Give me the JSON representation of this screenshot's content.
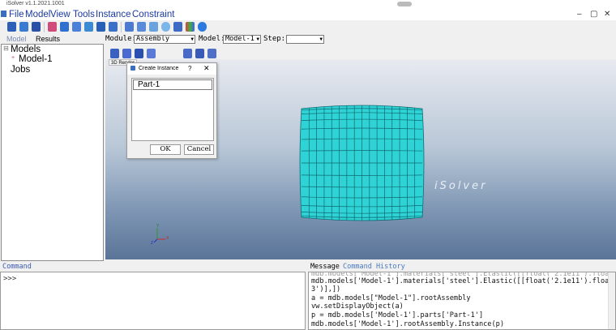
{
  "window": {
    "title": "iSolver v1.1.2021.1001"
  },
  "menu": [
    "File",
    "Model",
    "View",
    "Tools",
    "Instance",
    "Constraint"
  ],
  "window_controls": {
    "minimize": "–",
    "maximize": "▢",
    "close": "✕"
  },
  "left_tabs": {
    "model": "Model",
    "results": "Results"
  },
  "module_row": {
    "module_label": "Module:",
    "module_value": "Assembly",
    "model_label": "Model:",
    "model_value": "Model-1",
    "step_label": "Step:",
    "step_value": ""
  },
  "tree": {
    "root": "Models",
    "child": "Model-1",
    "jobs": "Jobs",
    "expander": "+"
  },
  "viewport": {
    "tab1": "3D Render",
    "watermark": "iSolver",
    "axis": {
      "y": "Y",
      "x": "X",
      "z": "Z"
    }
  },
  "dialog": {
    "title": "Create Instance",
    "help": "?",
    "close": "✕",
    "selected_part": "Part-1",
    "ok_label": "OK",
    "cancel_label": "Cancel"
  },
  "command": {
    "title": "Command",
    "prompt": ">>>"
  },
  "message": {
    "tab_message": "Message",
    "tab_history": "Command History",
    "lines": [
      "mdb.models['Model-1'].materials['steel'].Elastic([[float('2.1e11').float('0.",
      "3')],])",
      "a = mdb.models[\"Model-1\"].rootAssembly",
      "vw.setDisplayObject(a)",
      "p = mdb.models['Model-1'].parts['Part-1']",
      "mdb.models['Model-1'].rootAssembly.Instance(p)"
    ]
  },
  "colors": {
    "mesh_fill": "#2fd3d6",
    "mesh_line": "#0e6a70",
    "menu_text": "#1a3aa0",
    "accent": "#3a6ec0"
  }
}
